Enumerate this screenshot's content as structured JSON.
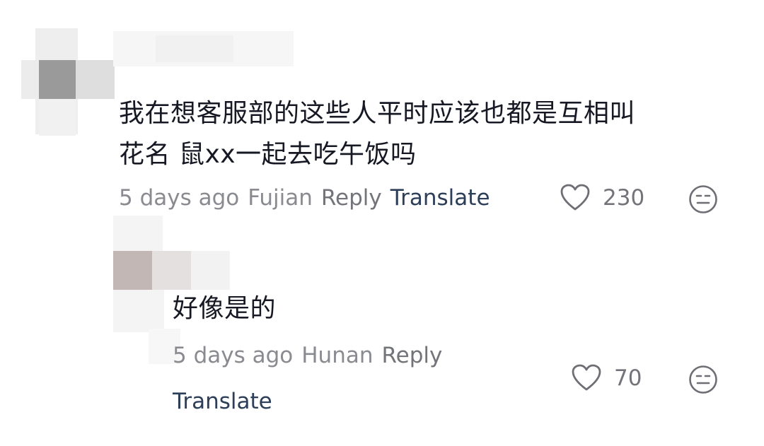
{
  "comments": [
    {
      "text_line1": "我在想客服部的这些人平时应该也都是互相叫",
      "text_line2": "花名 鼠xx一起去吃午饭吗",
      "time": "5 days ago",
      "location": "Fujian",
      "reply_label": "Reply",
      "translate_label": "Translate",
      "likes": "230",
      "like_icon": "heart-outline-icon",
      "dislike_icon": "meh-face-icon"
    },
    {
      "text": "好像是的",
      "time": "5 days ago",
      "location": "Hunan",
      "reply_label": "Reply",
      "translate_label": "Translate",
      "likes": "70",
      "like_icon": "heart-outline-icon",
      "dislike_icon": "meh-face-icon"
    }
  ],
  "colors": {
    "text": "#161823",
    "meta": "#8a8b91",
    "translate": "#2c3e58",
    "background": "#ffffff"
  }
}
